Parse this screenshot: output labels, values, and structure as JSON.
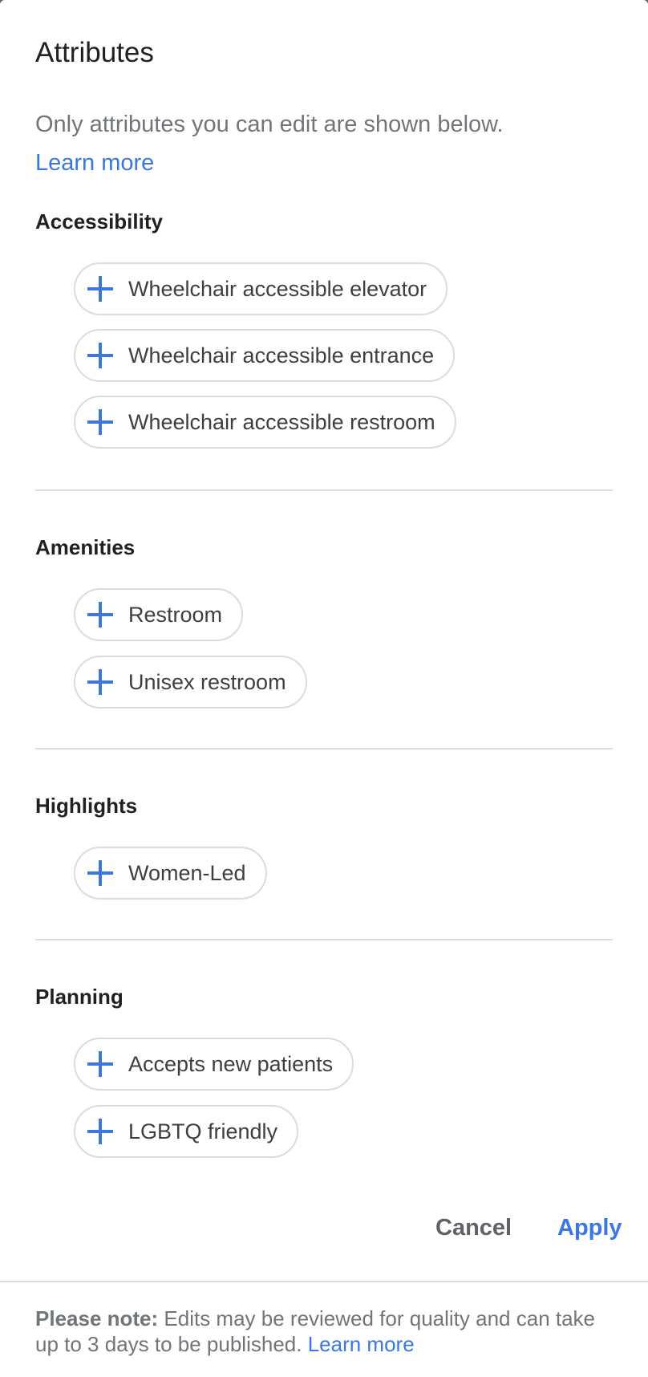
{
  "dialog": {
    "title": "Attributes",
    "subtitle": "Only attributes you can edit are shown below.",
    "learn_more": "Learn more"
  },
  "sections": [
    {
      "title": "Accessibility",
      "chips": [
        {
          "icon": "plus-icon",
          "label": "Wheelchair accessible elevator"
        },
        {
          "icon": "plus-icon",
          "label": "Wheelchair accessible entrance"
        },
        {
          "icon": "plus-icon",
          "label": "Wheelchair accessible restroom"
        }
      ]
    },
    {
      "title": "Amenities",
      "chips": [
        {
          "icon": "plus-icon",
          "label": "Restroom"
        },
        {
          "icon": "plus-icon",
          "label": "Unisex restroom"
        }
      ]
    },
    {
      "title": "Highlights",
      "chips": [
        {
          "icon": "plus-icon",
          "label": "Women-Led"
        }
      ]
    },
    {
      "title": "Planning",
      "chips": [
        {
          "icon": "plus-icon",
          "label": "Accepts new patients"
        },
        {
          "icon": "plus-icon",
          "label": "LGBTQ friendly"
        }
      ]
    }
  ],
  "actions": {
    "cancel_label": "Cancel",
    "apply_label": "Apply"
  },
  "footer": {
    "note_bold": "Please note:",
    "note_text": " Edits may be reviewed for quality and can take up to 3 days to be published. ",
    "learn_more": "Learn more"
  },
  "colors": {
    "accent": "#3a77e0",
    "chip_border": "#dadce0",
    "text_primary": "#202124",
    "text_secondary": "#70757a"
  }
}
